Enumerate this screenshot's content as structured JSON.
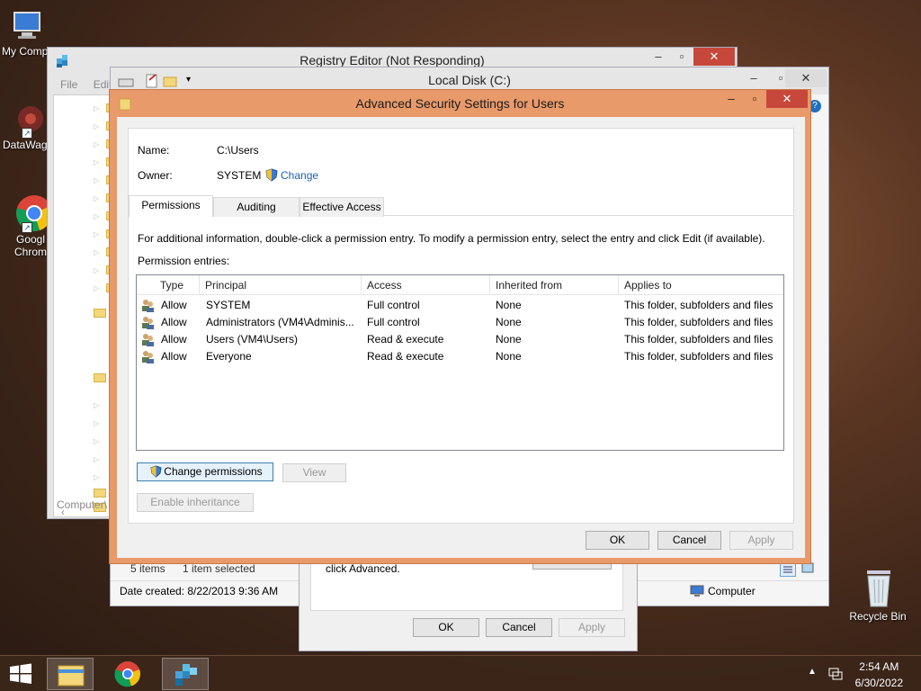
{
  "desktop": {
    "icons": [
      {
        "label": "My Comp",
        "icon": "computer-icon"
      },
      {
        "label": "DataWag",
        "icon": "datawag-icon"
      },
      {
        "label": "Googl\nChrom",
        "line1": "Googl",
        "line2": "Chrom",
        "icon": "chrome-icon"
      },
      {
        "label": "Recycle Bin",
        "icon": "recycle-bin-icon"
      }
    ]
  },
  "registry_editor": {
    "title": "Registry Editor (Not Responding)",
    "menu": [
      "File",
      "Edit"
    ],
    "status": "Computer\\"
  },
  "explorer": {
    "title": "Local Disk (C:)",
    "status_items": "5 items",
    "status_selected": "1 item selected",
    "date_created": "Date created: 8/22/2013 9:36 AM",
    "location": "Computer"
  },
  "properties_dialog": {
    "text": "click Advanced.",
    "ok": "OK",
    "cancel": "Cancel",
    "apply": "Apply"
  },
  "advanced_security": {
    "title": "Advanced Security Settings for Users",
    "name_label": "Name:",
    "name_value": "C:\\Users",
    "owner_label": "Owner:",
    "owner_value": "SYSTEM",
    "change_link": "Change",
    "tabs": [
      "Permissions",
      "Auditing",
      "Effective Access"
    ],
    "active_tab": "Permissions",
    "info_text": "For additional information, double-click a permission entry. To modify a permission entry, select the entry and click Edit (if available).",
    "entries_label": "Permission entries:",
    "columns": [
      "Type",
      "Principal",
      "Access",
      "Inherited from",
      "Applies to"
    ],
    "entries": [
      {
        "type": "Allow",
        "principal": "SYSTEM",
        "access": "Full control",
        "inherited": "None",
        "applies": "This folder, subfolders and files"
      },
      {
        "type": "Allow",
        "principal": "Administrators (VM4\\Adminis...",
        "access": "Full control",
        "inherited": "None",
        "applies": "This folder, subfolders and files"
      },
      {
        "type": "Allow",
        "principal": "Users (VM4\\Users)",
        "access": "Read & execute",
        "inherited": "None",
        "applies": "This folder, subfolders and files"
      },
      {
        "type": "Allow",
        "principal": "Everyone",
        "access": "Read & execute",
        "inherited": "None",
        "applies": "This folder, subfolders and files"
      }
    ],
    "change_permissions": "Change permissions",
    "view": "View",
    "enable_inheritance": "Enable inheritance",
    "ok": "OK",
    "cancel": "Cancel",
    "apply": "Apply"
  },
  "taskbar": {
    "time": "2:54 AM",
    "date": "6/30/2022"
  },
  "colors": {
    "accent_border": "#e99a6a",
    "close_button": "#c7483b",
    "link": "#1a5fb4"
  }
}
